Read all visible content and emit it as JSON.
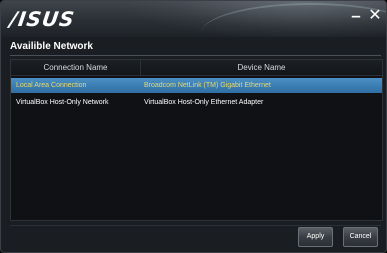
{
  "window": {
    "brand": "/ISUS",
    "minimize_glyph": "–",
    "close_glyph": "✕"
  },
  "section": {
    "title": "Availible Network"
  },
  "table": {
    "columns": [
      "Connection Name",
      "Device Name"
    ],
    "rows": [
      {
        "connection": "Local Area Connection",
        "device": "Broadcom NetLink (TM) Gigabit Ethernet",
        "selected": true
      },
      {
        "connection": "VirtualBox Host-Only Network",
        "device": "VirtualBox Host-Only Ethernet Adapter",
        "selected": false
      }
    ]
  },
  "buttons": {
    "apply": "Apply",
    "cancel": "Cancel"
  },
  "colors": {
    "selection": "#3a7fb5",
    "selected_text": "#e9d96a",
    "background": "#1a1d21"
  }
}
